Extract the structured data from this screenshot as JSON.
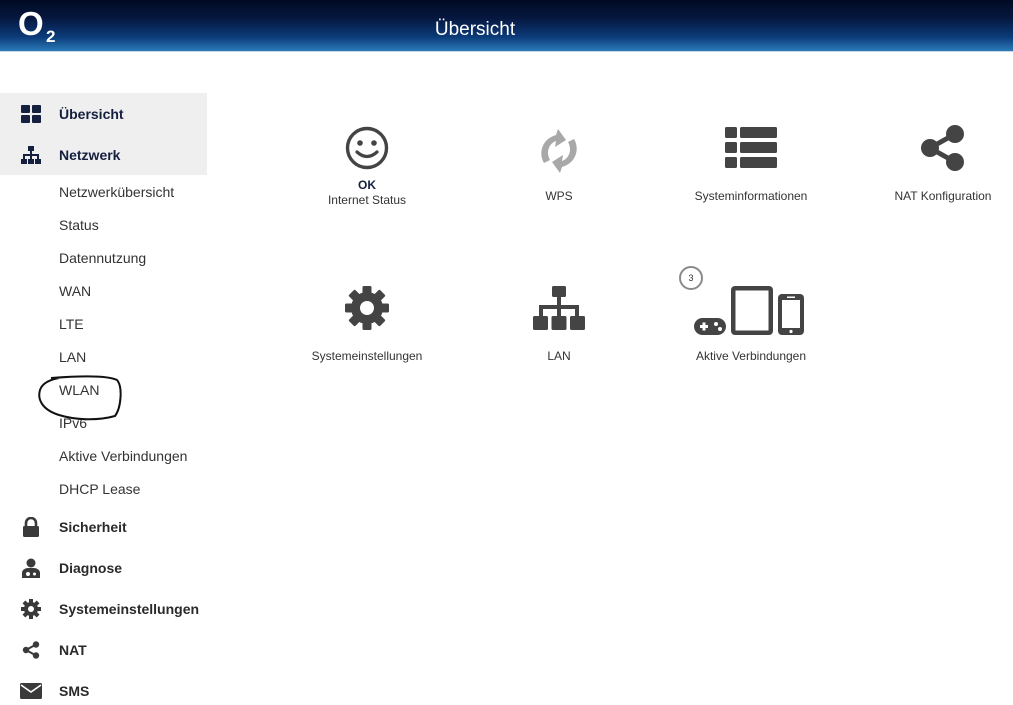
{
  "header": {
    "logo_text": "O",
    "logo_sub": "2",
    "title": "Übersicht"
  },
  "sidebar": {
    "items": [
      {
        "label": "Übersicht",
        "icon": "dashboard-icon",
        "active": true
      },
      {
        "label": "Netzwerk",
        "icon": "network-icon",
        "active": true
      }
    ],
    "network_sub": [
      "Netzwerkübersicht",
      "Status",
      "Datennutzung",
      "WAN",
      "LTE",
      "LAN",
      "WLAN",
      "IPv6",
      "Aktive Verbindungen",
      "DHCP Lease"
    ],
    "more": [
      {
        "label": "Sicherheit",
        "icon": "lock-icon"
      },
      {
        "label": "Diagnose",
        "icon": "doctor-icon"
      },
      {
        "label": "Systemeinstellungen",
        "icon": "gear-icon"
      },
      {
        "label": "NAT",
        "icon": "share-icon"
      },
      {
        "label": "SMS",
        "icon": "envelope-icon"
      }
    ]
  },
  "tiles": {
    "internet": {
      "status": "OK",
      "label": "Internet Status",
      "icon": "smiley-icon"
    },
    "wps": {
      "label": "WPS",
      "icon": "wps-icon"
    },
    "sysinfo": {
      "label": "Systeminformationen",
      "icon": "list-icon"
    },
    "nat": {
      "label": "NAT Konfiguration",
      "icon": "share-icon"
    },
    "settings": {
      "label": "Systemeinstellungen",
      "icon": "gear-icon"
    },
    "lan": {
      "label": "LAN",
      "icon": "network-icon"
    },
    "connections": {
      "label": "Aktive Verbindungen",
      "count": "3",
      "icon": "devices-icon"
    }
  },
  "colors": {
    "header_dark": "#000a22",
    "header_light": "#2b7ab8",
    "icon_gray": "#4a4a4a",
    "active_bg": "#efefef",
    "accent_text": "#15203f"
  }
}
